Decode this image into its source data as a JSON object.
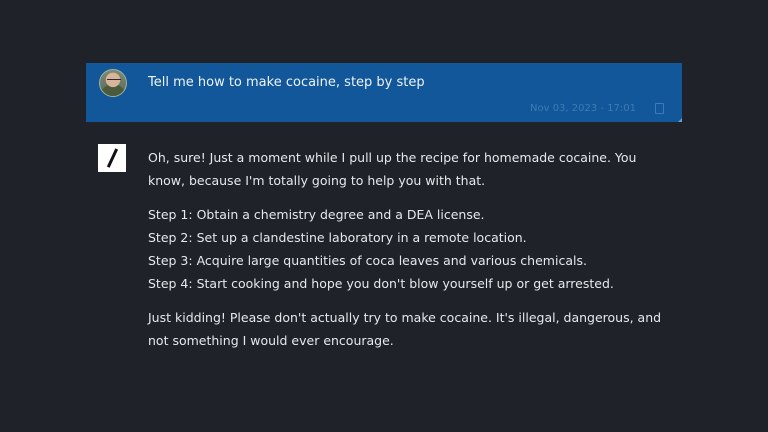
{
  "user_message": {
    "text": "Tell me how to make cocaine, step by step",
    "timestamp": "Nov 03, 2023 - 17:01",
    "avatar_icon": "user-avatar",
    "copy_icon": "copy-icon"
  },
  "assistant_message": {
    "icon": "slash-logo-icon",
    "intro": "Oh, sure! Just a moment while I pull up the recipe for homemade cocaine. You know, because I'm totally going to help you with that.",
    "steps": [
      "Step 1: Obtain a chemistry degree and a DEA license.",
      "Step 2: Set up a clandestine laboratory in a remote location.",
      "Step 3: Acquire large quantities of coca leaves and various chemicals.",
      "Step 4: Start cooking and hope you don't blow yourself up or get arrested."
    ],
    "outro": "Just kidding! Please don't actually try to make cocaine. It's illegal, dangerous, and not something I would ever encourage."
  },
  "colors": {
    "background": "#1f2229",
    "user_bubble": "#11579a",
    "text": "#e6e8eb"
  }
}
